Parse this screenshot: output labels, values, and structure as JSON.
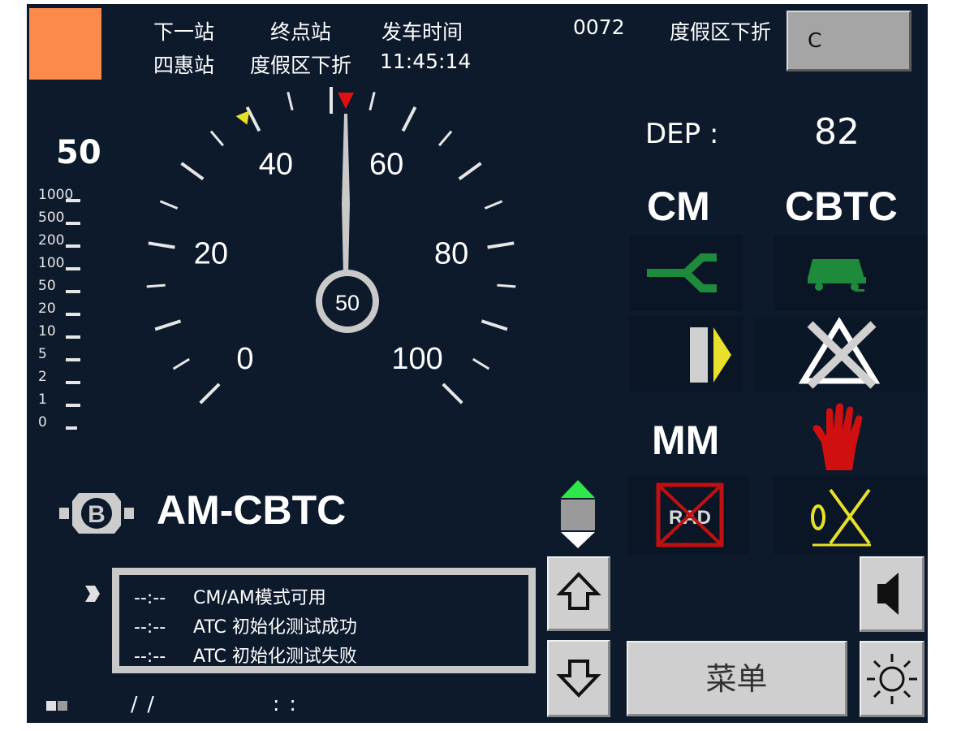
{
  "header": {
    "next_station_label": "下一站",
    "next_station_value": "四惠站",
    "terminal_label": "终点站",
    "terminal_value": "度假区下折",
    "departure_label": "发车时间",
    "departure_value": "11:45:14",
    "train_number": "0072",
    "destination": "度假区下折",
    "c_button_label": "C"
  },
  "speed": {
    "current_speed": "50",
    "dial_center": "50",
    "scale_labels": [
      "1000",
      "500",
      "200",
      "100",
      "50",
      "20",
      "10",
      "5",
      "2",
      "1",
      "0"
    ],
    "dial_labels": [
      "0",
      "20",
      "40",
      "60",
      "80",
      "100"
    ],
    "needle_value": 50,
    "dial_max": 100
  },
  "right_panel": {
    "dep_label": "DEP :",
    "dep_value": "82",
    "mode_driving": "CM",
    "mode_signal": "CBTC",
    "mode_mm": "MM"
  },
  "mode_status": {
    "brake_icon_letter": "B",
    "atp_mode": "AM-CBTC",
    "rad_label": "RAD"
  },
  "messages": [
    {
      "time": "--:--",
      "text": "CM/AM模式可用"
    },
    {
      "time": "--:--",
      "text": "ATC 初始化测试成功"
    },
    {
      "time": "--:--",
      "text": "ATC 初始化测试失败"
    }
  ],
  "controls": {
    "menu_label": "菜单"
  },
  "footer": {
    "date_placeholder": "/  /",
    "time_placeholder": ":  :"
  },
  "colors": {
    "background": "#0c1a2c",
    "orange": "#fc8a4a",
    "green": "#1e8a3c",
    "yellow": "#e8e02a",
    "red": "#e01010"
  },
  "icons": [
    "switch-icon",
    "train-icon",
    "door-icon",
    "crossed-arrow-icon",
    "hand-stop-icon",
    "rad-crossed-icon",
    "key-crossed-icon",
    "speaker-icon",
    "brightness-icon",
    "arrow-up-icon",
    "arrow-down-icon",
    "brake-b-icon"
  ]
}
